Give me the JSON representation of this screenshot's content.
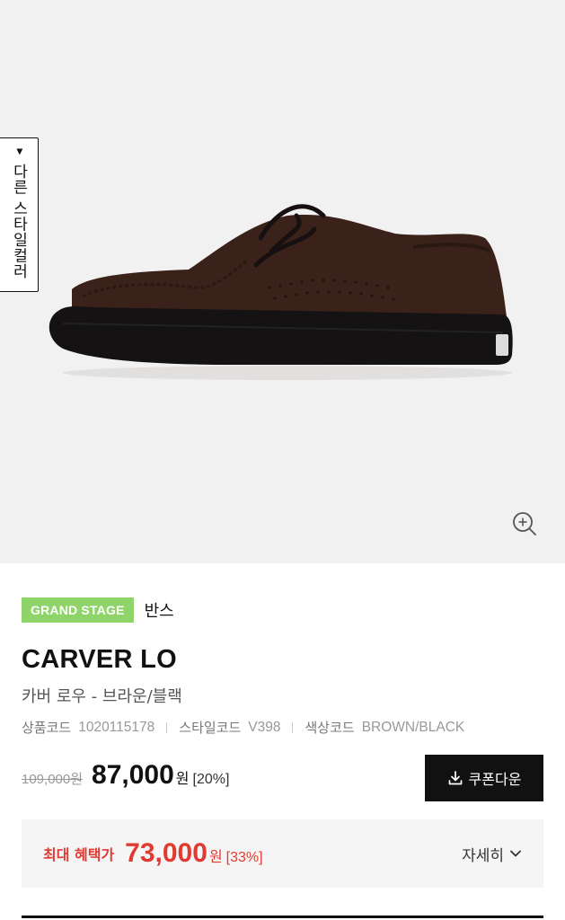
{
  "hero": {
    "style_tab_label": "다른 스타일컬러",
    "style_tab_arrow": "▶",
    "zoom_icon": "zoom-in-icon"
  },
  "product": {
    "badge": "GRAND STAGE",
    "brand": "반스",
    "name": "CARVER LO",
    "subtitle": "카버 로우 - 브라운/블랙",
    "meta": [
      {
        "key": "상품코드",
        "value": "1020115178"
      },
      {
        "key": "스타일코드",
        "value": "V398"
      },
      {
        "key": "색상코드",
        "value": "BROWN/BLACK"
      }
    ],
    "original_price": "109,000원",
    "sale_price": "87,000",
    "currency": "원",
    "discount": "[20%]",
    "coupon_button": "쿠폰다운"
  },
  "benefit": {
    "label": "최대 혜택가",
    "price": "73,000",
    "currency": "원",
    "discount": "[33%]",
    "detail": "자세히"
  },
  "colors": {
    "badge_green": "#8fd468",
    "accent_red": "#e03b32",
    "button_black": "#111111"
  }
}
